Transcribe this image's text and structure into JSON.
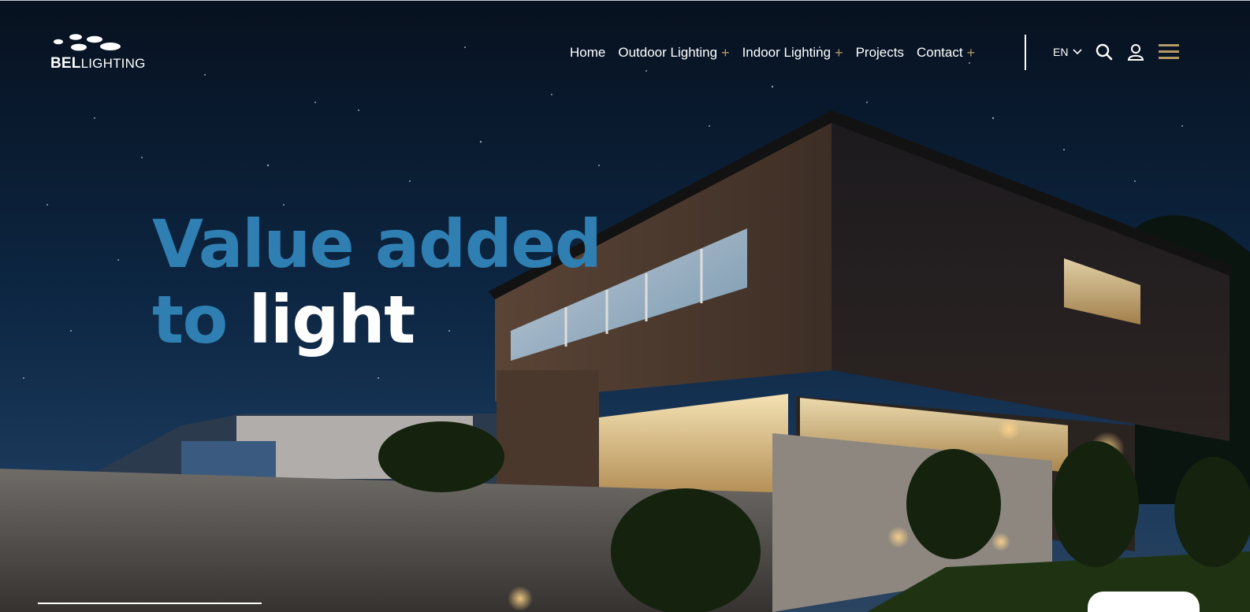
{
  "brand": {
    "name_bold": "BEL",
    "name_light": "LIGHTING"
  },
  "nav": {
    "items": [
      {
        "label": "Home",
        "has_submenu": false
      },
      {
        "label": "Outdoor Lighting",
        "has_submenu": true
      },
      {
        "label": "Indoor Lighting",
        "has_submenu": true
      },
      {
        "label": "Projects",
        "has_submenu": false
      },
      {
        "label": "Contact",
        "has_submenu": true
      }
    ],
    "submenu_symbol": "+"
  },
  "language": {
    "current": "EN"
  },
  "icons": [
    "search-icon",
    "user-icon",
    "menu-icon",
    "chevron-down-icon"
  ],
  "hero": {
    "line1": "Value added",
    "line2_accent": "to",
    "line2_main": "light"
  },
  "colors": {
    "accent_blue": "#2f7fb3",
    "accent_gold": "#b49a63",
    "text": "#ffffff"
  }
}
